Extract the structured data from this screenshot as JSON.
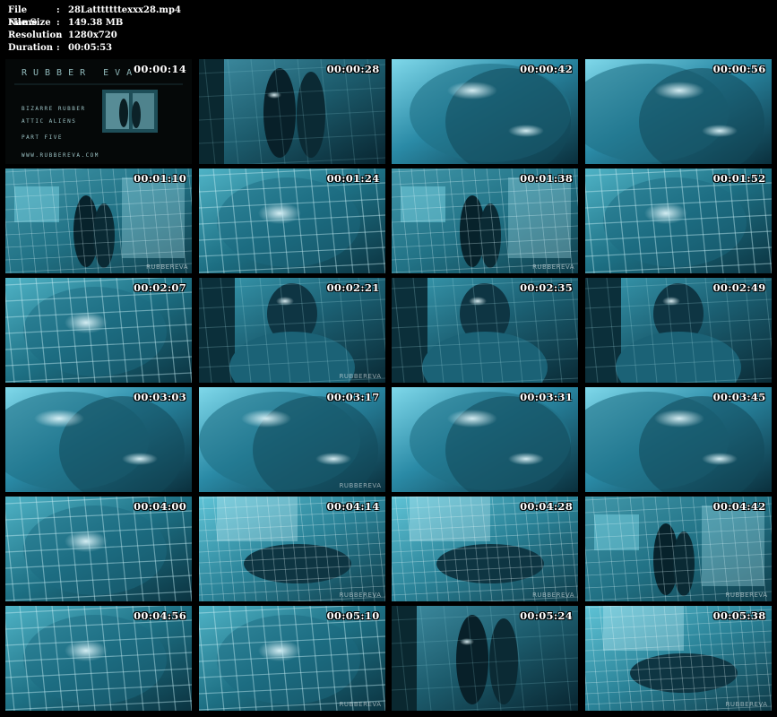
{
  "info": {
    "file_name_label": "File Name",
    "file_name": "28Latttttttexxx28.mp4",
    "file_size_label": "File Size",
    "file_size": "149.38 MB",
    "resolution_label": "Resolution",
    "resolution": "1280x720",
    "duration_label": "Duration",
    "duration": "00:05:53",
    "separator": ":"
  },
  "title_card": {
    "brand": "RUBBER EVA",
    "line1": "BIZARRE RUBBER",
    "line2": "ATTIC ALIENS",
    "line3": "PART FIVE",
    "footer": "WWW.RUBBEREVA.COM"
  },
  "watermark": "RUBBEREVA",
  "thumbnails": [
    {
      "time": "00:00:14",
      "scene": "title"
    },
    {
      "time": "00:00:28",
      "scene": "figures"
    },
    {
      "time": "00:00:42",
      "scene": "closeup"
    },
    {
      "time": "00:00:56",
      "scene": "closeup"
    },
    {
      "time": "00:01:10",
      "scene": "room"
    },
    {
      "time": "00:01:24",
      "scene": "cage"
    },
    {
      "time": "00:01:38",
      "scene": "room"
    },
    {
      "time": "00:01:52",
      "scene": "cage"
    },
    {
      "time": "00:02:07",
      "scene": "cage"
    },
    {
      "time": "00:02:21",
      "scene": "hood"
    },
    {
      "time": "00:02:35",
      "scene": "hood"
    },
    {
      "time": "00:02:49",
      "scene": "hood"
    },
    {
      "time": "00:03:03",
      "scene": "closeup"
    },
    {
      "time": "00:03:17",
      "scene": "closeup"
    },
    {
      "time": "00:03:31",
      "scene": "closeup"
    },
    {
      "time": "00:03:45",
      "scene": "closeup"
    },
    {
      "time": "00:04:00",
      "scene": "cage"
    },
    {
      "time": "00:04:14",
      "scene": "cagewide"
    },
    {
      "time": "00:04:28",
      "scene": "cagewide"
    },
    {
      "time": "00:04:42",
      "scene": "room"
    },
    {
      "time": "00:04:56",
      "scene": "cage"
    },
    {
      "time": "00:05:10",
      "scene": "cage"
    },
    {
      "time": "00:05:24",
      "scene": "figures"
    },
    {
      "time": "00:05:38",
      "scene": "cagewide"
    }
  ],
  "colors": {
    "background": "#000000",
    "text": "#ffffff",
    "latex_cyan": "#3fb4cc",
    "latex_dark": "#0a2c38"
  }
}
